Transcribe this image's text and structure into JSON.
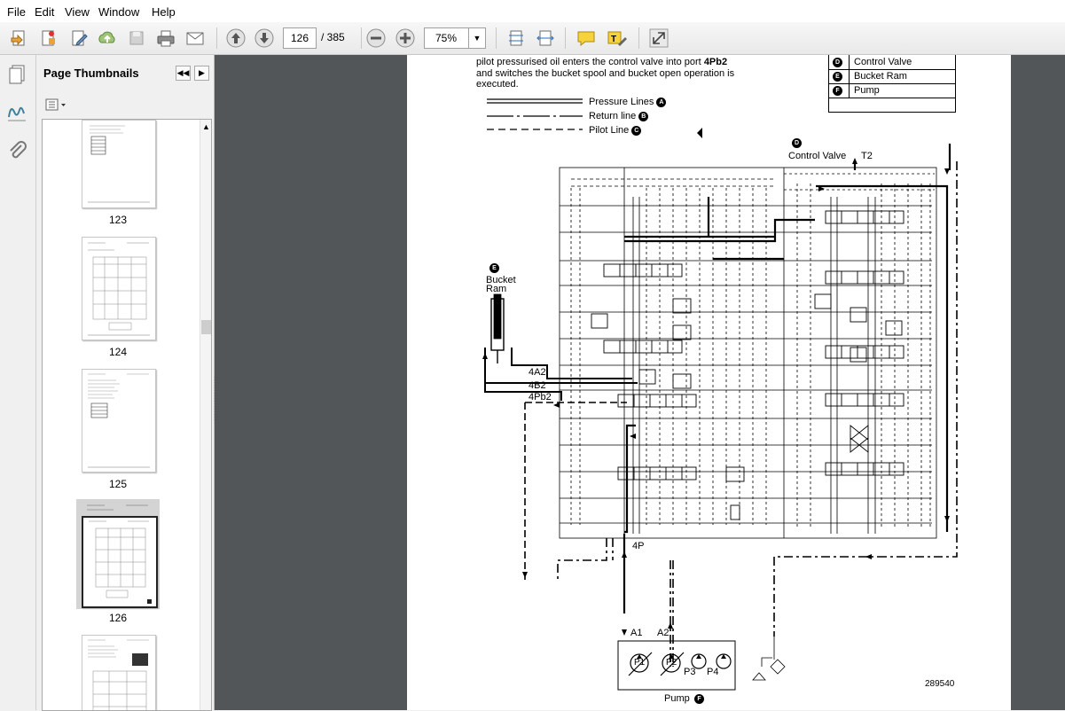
{
  "menu": [
    "File",
    "Edit",
    "View",
    "Window",
    "Help"
  ],
  "toolbar": {
    "current_page": "126",
    "page_count": "/ 385",
    "zoom": "75%"
  },
  "panel": {
    "title": "Page Thumbnails",
    "thumbnails": [
      {
        "label": "123"
      },
      {
        "label": "124"
      },
      {
        "label": "125"
      },
      {
        "label": "126",
        "selected": true
      },
      {
        "label": ""
      }
    ]
  },
  "document": {
    "intro_line1_a": "pilot pressurised oil enters the control valve into port ",
    "intro_line1_b": "4Pb2",
    "intro_line2": "and switches the bucket spool and bucket open operation is",
    "intro_line3": "executed.",
    "key_table": [
      {
        "letter": "D",
        "label": "Control Valve"
      },
      {
        "letter": "E",
        "label": "Bucket Ram"
      },
      {
        "letter": "F",
        "label": "Pump"
      }
    ],
    "line_legend": [
      {
        "label": "Pressure Lines",
        "letter": "A"
      },
      {
        "label": "Return line",
        "letter": "B"
      },
      {
        "label": "Pilot Line",
        "letter": "C"
      }
    ],
    "diagram": {
      "control_valve_letter": "D",
      "control_valve_label": "Control Valve",
      "t2": "T2",
      "bucket_ram_letter": "E",
      "bucket_ram_line1": "Bucket",
      "bucket_ram_line2": "Ram",
      "port_4a2": "4A2",
      "port_4b2": "4B2",
      "port_4pb2": "4Pb2",
      "port_4p": "4P",
      "a1": "A1",
      "a2": "A2",
      "p1": "P1",
      "p2": "P2",
      "p3": "P3",
      "p4": "P4",
      "pump_label": "Pump",
      "pump_letter": "F",
      "figure_id": "289540"
    }
  },
  "colors": {
    "viewer_bg": "#525659",
    "accent_blue": "#2a6fbe",
    "toolbar_bg": "#efefef"
  }
}
